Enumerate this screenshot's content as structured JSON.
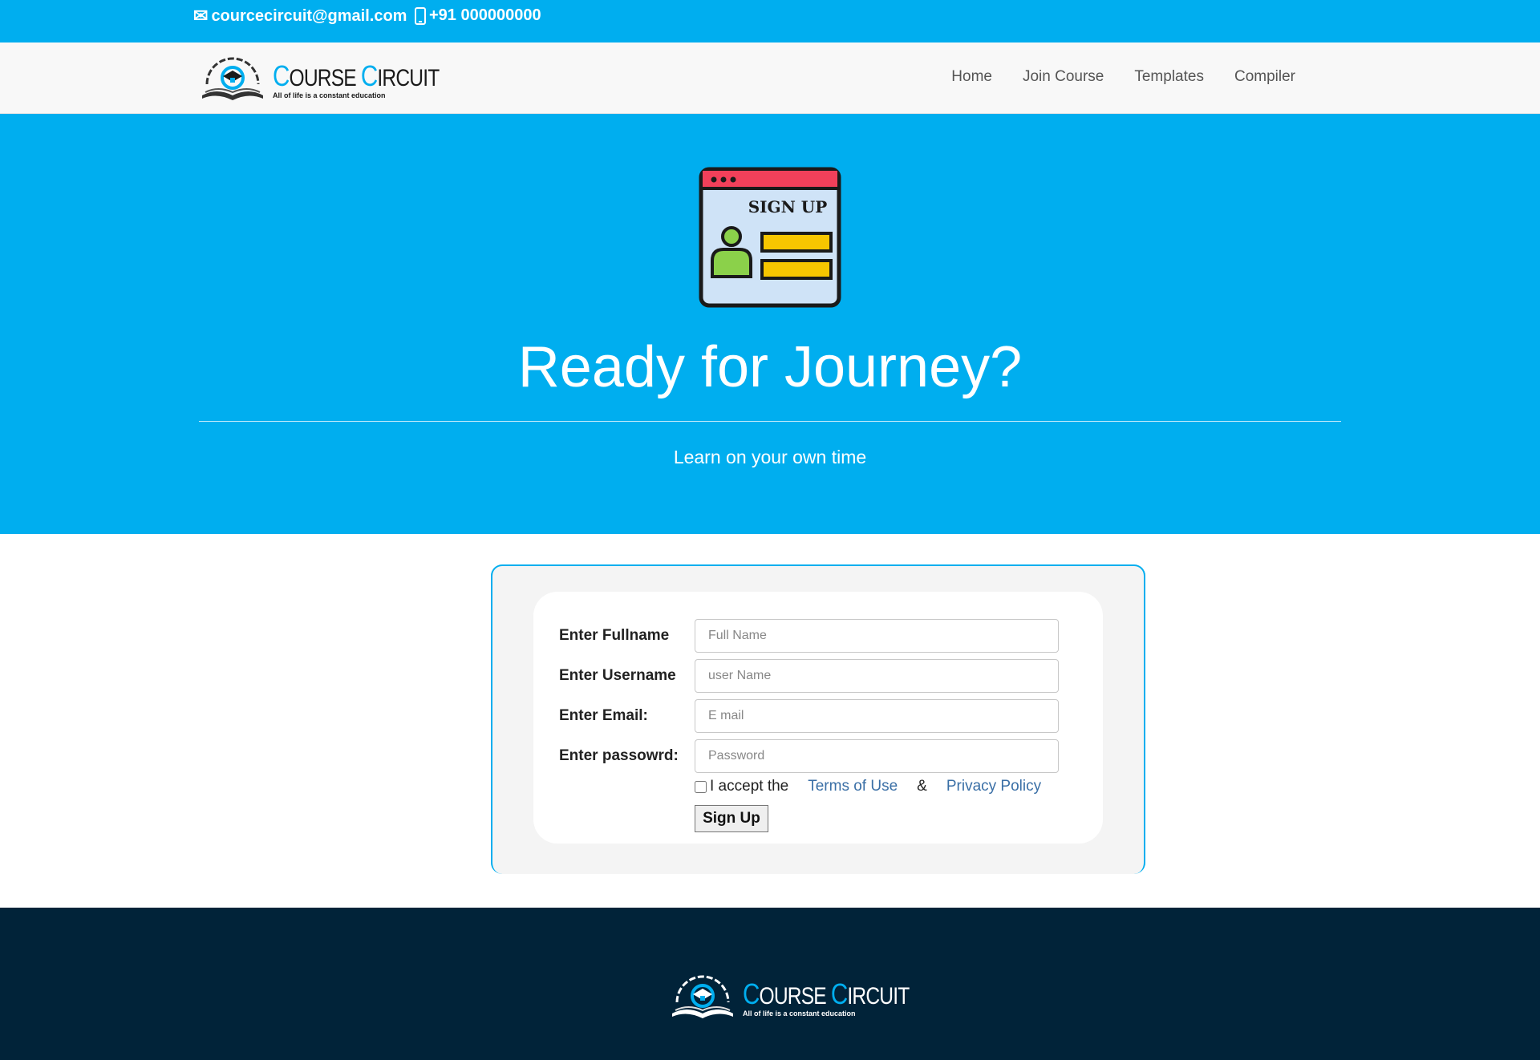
{
  "topbar": {
    "email": "courcecircuit@gmail.com",
    "phone": "+91 000000000",
    "email_icon": "envelope-icon",
    "phone_icon": "mobile-phone-icon"
  },
  "brand": {
    "first_cap": "C",
    "first_rest": "OURSE",
    "second_cap": "C",
    "second_rest": "IRCUIT",
    "tagline": "All of life is a constant education"
  },
  "nav": {
    "items": [
      {
        "label": "Home"
      },
      {
        "label": "Join Course"
      },
      {
        "label": "Templates"
      },
      {
        "label": "Compiler"
      }
    ]
  },
  "hero": {
    "illustration_text": "SIGN UP",
    "title": "Ready for Journey?",
    "subtitle": "Learn on your own time"
  },
  "form": {
    "fullname_label": "Enter Fullname",
    "fullname_placeholder": "Full Name",
    "username_label": "Enter Username",
    "username_placeholder": "user Name",
    "email_label": "Enter Email:",
    "email_placeholder": "E mail",
    "password_label": "Enter passowrd:",
    "password_placeholder": "Password",
    "accept_text": "I accept the",
    "terms_link": "Terms of Use",
    "ampersand": "&",
    "privacy_link": "Privacy Policy",
    "submit_label": "Sign Up"
  },
  "colors": {
    "accent": "#00aeef",
    "footer_bg": "#012339",
    "link": "#3a6fa6"
  }
}
